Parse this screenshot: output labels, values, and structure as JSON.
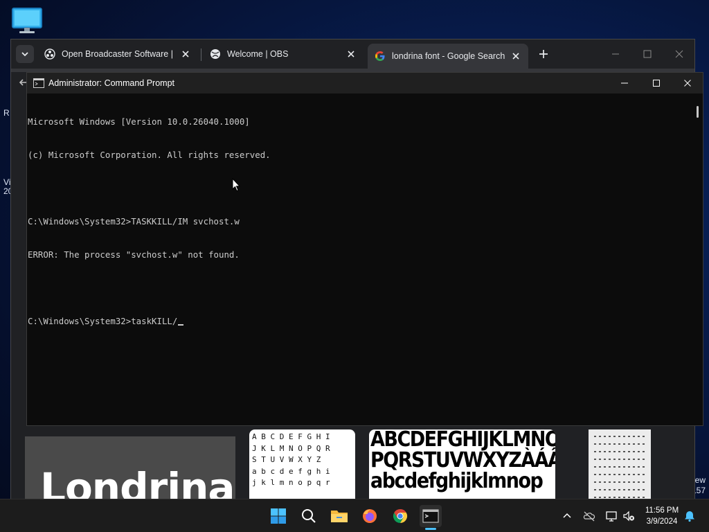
{
  "desktop": {
    "left_fragments": [
      "R",
      "Vi",
      "20"
    ],
    "right_fragments": [
      "ew",
      "157"
    ]
  },
  "browser": {
    "tabs": [
      {
        "title": "Open Broadcaster Software | OBS",
        "active": false
      },
      {
        "title": "Welcome | OBS",
        "active": false
      },
      {
        "title": "londrina font - Google Search",
        "active": true
      }
    ],
    "new_tab_icon": "plus-icon",
    "images": {
      "dark_preview_text": "Londrina",
      "grid_preview_text": "A B C D E F G H I\nJ K L M N O P Q R\nS T U V W X Y Z\na b c d e f g h i\nj k l m n o p q r",
      "abc_preview_lines": [
        "ABCDEFGHIJKLMNO",
        "PQRSTUVWXYZÀÁÂÉÍ",
        "abcdefghijklmnop"
      ]
    }
  },
  "cmd": {
    "title": "Administrator: Command Prompt",
    "lines": [
      "Microsoft Windows [Version 10.0.26040.1000]",
      "(c) Microsoft Corporation. All rights reserved.",
      "",
      "C:\\Windows\\System32>TASKKILL/IM svchost.w",
      "ERROR: The process \"svchost.w\" not found.",
      "",
      "C:\\Windows\\System32>taskKILL/"
    ]
  },
  "taskbar": {
    "icons": [
      "start-icon",
      "search-icon",
      "file-explorer-icon",
      "firefox-icon",
      "chrome-icon",
      "terminal-icon"
    ],
    "tray_icons": [
      "chevron-up-icon",
      "onedrive-icon",
      "network-icon",
      "volume-muted-icon",
      "notification-bell-icon"
    ],
    "time": "11:56 PM",
    "date": "3/9/2024"
  },
  "colors": {
    "accent": "#4cc2ff",
    "console_bg": "#0c0c0c",
    "console_text": "#cccccc",
    "taskbar_bg": "#1c1c1c"
  }
}
